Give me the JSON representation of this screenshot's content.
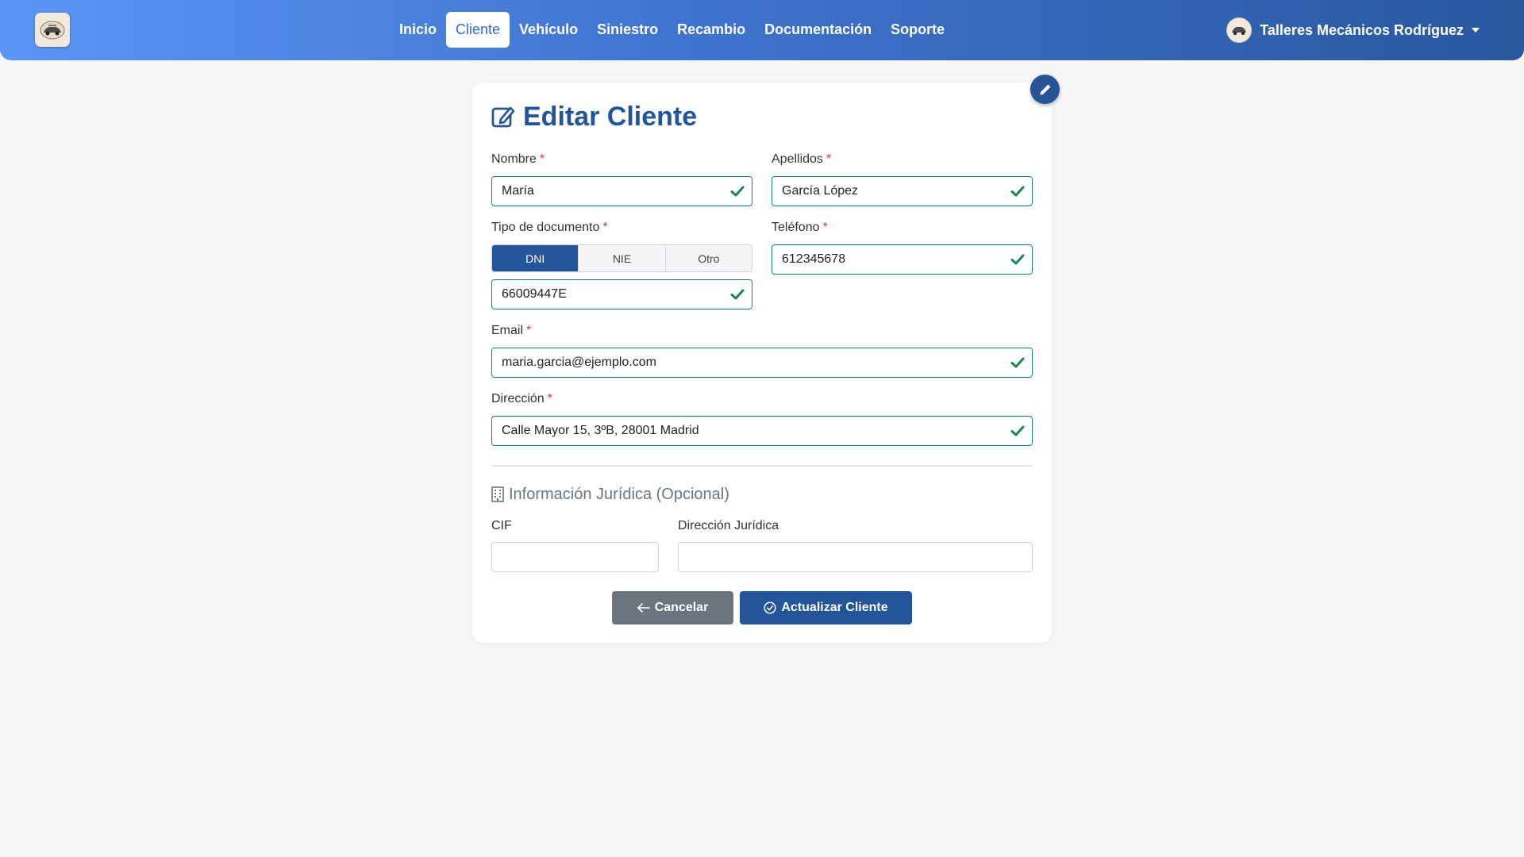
{
  "nav": {
    "items": [
      {
        "label": "Inicio",
        "active": false
      },
      {
        "label": "Cliente",
        "active": true
      },
      {
        "label": "Vehículo",
        "active": false
      },
      {
        "label": "Siniestro",
        "active": false
      },
      {
        "label": "Recambio",
        "active": false
      },
      {
        "label": "Documentación",
        "active": false
      },
      {
        "label": "Soporte",
        "active": false
      }
    ],
    "user_name": "Talleres Mecánicos Rodríguez"
  },
  "form": {
    "title": "Editar Cliente",
    "required_mark": "*",
    "nombre": {
      "label": "Nombre",
      "value": "María"
    },
    "apellidos": {
      "label": "Apellidos",
      "value": "García López"
    },
    "tipo_documento": {
      "label": "Tipo de documento",
      "options": [
        "DNI",
        "NIE",
        "Otro"
      ],
      "selected": "DNI",
      "value": "66009447E"
    },
    "telefono": {
      "label": "Teléfono",
      "value": "612345678"
    },
    "email": {
      "label": "Email",
      "value": "maria.garcia@ejemplo.com"
    },
    "direccion": {
      "label": "Dirección",
      "value": "Calle Mayor 15, 3ºB, 28001 Madrid"
    },
    "juridica": {
      "title": "Información Jurídica (Opcional)",
      "cif": {
        "label": "CIF",
        "value": ""
      },
      "direccion_juridica": {
        "label": "Dirección Jurídica",
        "value": ""
      }
    },
    "buttons": {
      "cancel": "Cancelar",
      "update": "Actualizar Cliente"
    }
  },
  "colors": {
    "primary": "#23559a",
    "valid": "#198754",
    "required": "#dc3545",
    "secondary": "#6c757d"
  }
}
